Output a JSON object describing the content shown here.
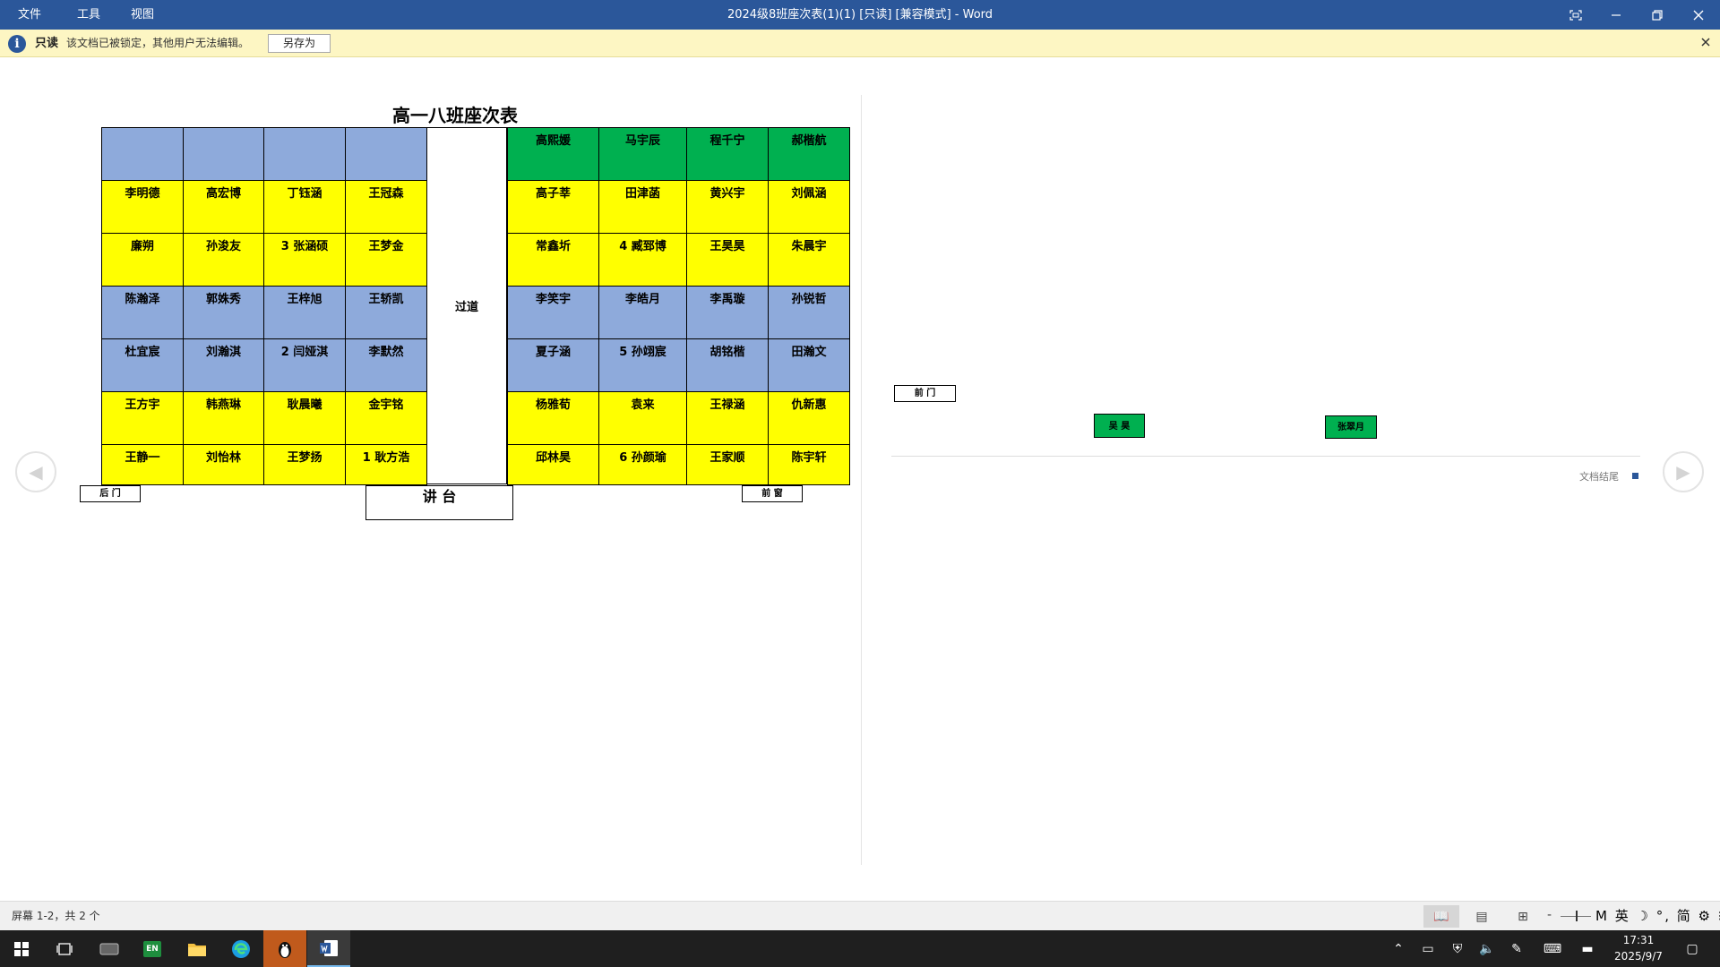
{
  "titlebar": {
    "menu": [
      "文件",
      "工具",
      "视图"
    ],
    "title": "2024级8班座次表(1)(1) [只读] [兼容模式] - Word",
    "fit_icon": "fit-screen-icon",
    "minimize_icon": "minimize-icon",
    "restore_icon": "restore-icon",
    "close_icon": "close-icon"
  },
  "infobar": {
    "label": "只读",
    "message": "该文档已被锁定，其他用户无法编辑。",
    "save_as": "另存为"
  },
  "document": {
    "title": "高一八班座次表",
    "aisle": "过道",
    "back_door": "后 门",
    "front_window_left": "前 窗",
    "podium": "讲 台",
    "front_door": "前 门",
    "green_label_1": "吴 昊",
    "green_label_2": "张翠月",
    "end_of_document": "文档结尾",
    "seat_rows": [
      {
        "color": "blue",
        "right_color": "green",
        "left": [
          "",
          "",
          "",
          ""
        ],
        "right": [
          "高熙媛",
          "马宇辰",
          "程千宁",
          "郝楷航"
        ]
      },
      {
        "color": "yellow",
        "right_color": "yellow",
        "left": [
          "李明德",
          "高宏博",
          "丁钰涵",
          "王冠森"
        ],
        "right": [
          "高子莘",
          "田津菡",
          "黄兴宇",
          "刘佩涵"
        ]
      },
      {
        "color": "yellow",
        "right_color": "yellow",
        "left": [
          "廉朔",
          "孙浚友",
          "3 张涵硕",
          "王梦金"
        ],
        "right": [
          "常鑫圻",
          "4 臧郅博",
          "王昊昊",
          "朱晨宇"
        ]
      },
      {
        "color": "blue",
        "right_color": "blue",
        "left": [
          "陈瀚泽",
          "郭姝秀",
          "王梓旭",
          "王轿凯"
        ],
        "right": [
          "李笑宇",
          "李皓月",
          "李禹璇",
          "孙锐哲"
        ]
      },
      {
        "color": "blue",
        "right_color": "blue",
        "left": [
          "杜宜宸",
          "刘瀚淇",
          "2 闫娅淇",
          "李默然"
        ],
        "right": [
          "夏子涵",
          "5 孙翊宸",
          "胡铭楷",
          "田瀚文"
        ]
      },
      {
        "color": "yellow",
        "right_color": "yellow",
        "left": [
          "王方宇",
          "韩燕琳",
          "耿晨曦",
          "金宇铭"
        ],
        "right": [
          "杨雅荀",
          "袁来",
          "王禄涵",
          "仇新惠"
        ]
      },
      {
        "color": "yellow",
        "right_color": "yellow",
        "left": [
          "王静一",
          "刘怡林",
          "王梦扬",
          "1 耿方浩"
        ],
        "right": [
          "邱林昊",
          "6 孙颜瑜",
          "王家顺",
          "陈宇轩"
        ]
      }
    ]
  },
  "statusbar": {
    "page_info": "屏幕 1-2，共 2 个",
    "zoom_minus": "-",
    "ime": "M 英 ☽ °, 简 ⚙ ⁝"
  },
  "taskbar": {
    "clock_time": "17:31",
    "clock_date": "2025/9/7",
    "en_label": "EN"
  },
  "colors": {
    "titlebar": "#2b579a",
    "seat_blue": "#8eaadb",
    "seat_yellow": "#ffff00",
    "seat_green": "#00b050"
  }
}
